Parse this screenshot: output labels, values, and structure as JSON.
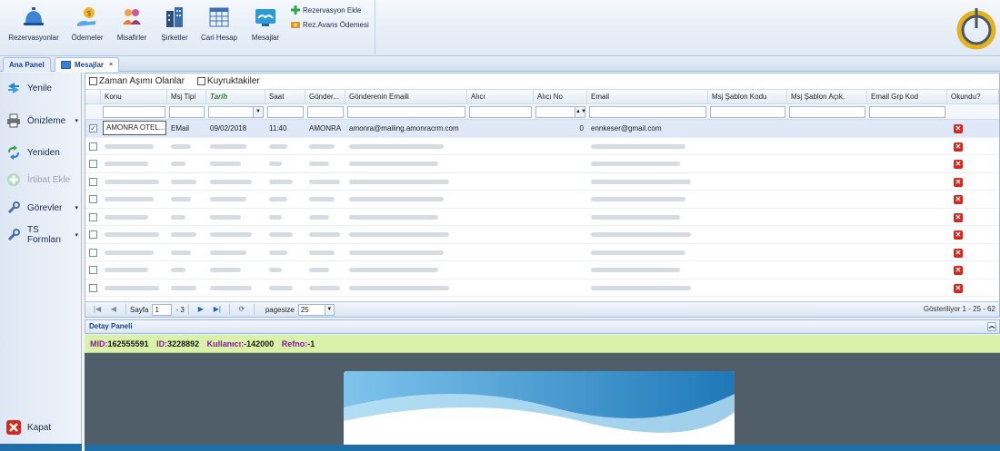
{
  "toolbar": {
    "buttons": [
      {
        "label": "Rezervasyonlar",
        "icon": "bell-icon"
      },
      {
        "label": "Ödemeler",
        "icon": "money-hand-icon"
      },
      {
        "label": "Misafirler",
        "icon": "guests-icon"
      },
      {
        "label": "Şirketler",
        "icon": "buildings-icon"
      },
      {
        "label": "Cari Hesap",
        "icon": "spreadsheet-icon"
      },
      {
        "label": "Mesajlar",
        "icon": "messages-icon"
      }
    ],
    "small_buttons": [
      {
        "label": "Rezervasyon Ekle",
        "icon": "plus-icon"
      },
      {
        "label": "Rez.Avans Ödemesi",
        "icon": "coins-icon"
      }
    ]
  },
  "tabs": [
    {
      "label": "Ana Panel"
    },
    {
      "label": "Mesajlar",
      "close": "×"
    }
  ],
  "sidebar": {
    "items": [
      {
        "label": "Yenile",
        "icon": "refresh-icon"
      },
      {
        "label": "Önizleme",
        "icon": "printer-icon",
        "arrow": "▾"
      },
      {
        "label": "Yeniden",
        "icon": "resend-icon"
      },
      {
        "label": "İrtibat Ekle",
        "icon": "add-contact-icon",
        "disabled": true
      },
      {
        "label": "Görevler",
        "icon": "wrench-icon",
        "arrow": "▾"
      },
      {
        "label": "TS Formları",
        "icon": "wrench-icon",
        "arrow": "▾"
      }
    ],
    "close_label": "Kapat"
  },
  "filters": {
    "timeout_label": "Zaman Aşımı Olanlar",
    "queue_label": "Kuyruktakiler"
  },
  "grid": {
    "columns": [
      "Konu",
      "Msj Tipi",
      "Tarih",
      "Saat",
      "Gönder...",
      "Gönderenin Emaili",
      "Alıcı",
      "Alıcı No",
      "Email",
      "Msj Şablon Kodu",
      "Msj Şablon Açık.",
      "Email Grp Kod",
      "Okundu?"
    ],
    "first_row": {
      "checked": "✓",
      "konu": "AMONRA OTEL...",
      "msj_tipi": "EMail",
      "tarih": "09/02/2018",
      "saat": "11:40",
      "gonderen": "AMONRA",
      "gonderen_email": "amonra@mailing.amonracrm.com",
      "alici_no": "0",
      "email": "ennkeser@gmail.com",
      "okundu": "✕"
    },
    "blurred_row_count": 9,
    "okundu_symbol": "✕"
  },
  "pager": {
    "page_label": "Sayfa",
    "page_value": "1",
    "page_of": "- 3",
    "pagesize_label": "pagesize",
    "pagesize_value": "25",
    "info": "Gösteriliyor 1 - 25 - 62"
  },
  "detail": {
    "title": "Detay Paneli",
    "mid_label": "MID:",
    "mid_value": "162555591",
    "id_label": "ID:",
    "id_value": "3228892",
    "user_label": "Kullanıcı:",
    "user_value": "-142000",
    "ref_label": "Refno:",
    "ref_value": "-1"
  },
  "colors": {
    "accent": "#15428b",
    "info_bar": "#d9f1a8",
    "read_x": "#d9261c",
    "preview_bg": "#505e6a"
  }
}
